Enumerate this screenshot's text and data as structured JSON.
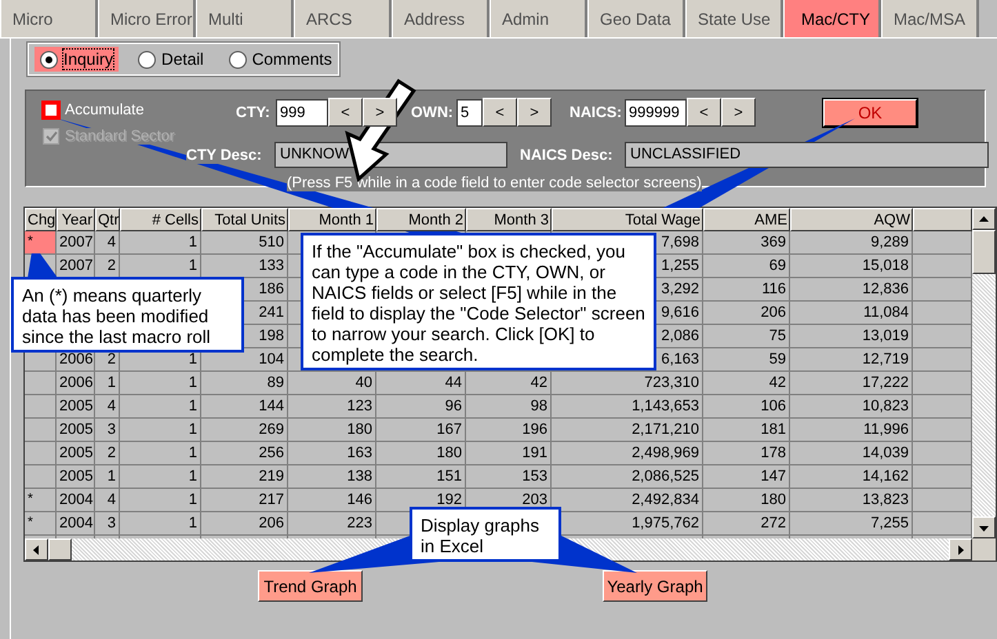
{
  "tabs": [
    {
      "label": "Micro",
      "selected": false
    },
    {
      "label": "Micro Error",
      "selected": false
    },
    {
      "label": "Multi",
      "selected": false
    },
    {
      "label": "ARCS",
      "selected": false
    },
    {
      "label": "Address",
      "selected": false
    },
    {
      "label": "Admin",
      "selected": false
    },
    {
      "label": "Geo Data",
      "selected": false
    },
    {
      "label": "State Use",
      "selected": false
    },
    {
      "label": "Mac/CTY",
      "selected": true
    },
    {
      "label": "Mac/MSA",
      "selected": false
    }
  ],
  "view_options": [
    {
      "label": "Inquiry",
      "selected": true
    },
    {
      "label": "Detail",
      "selected": false
    },
    {
      "label": "Comments",
      "selected": false
    }
  ],
  "filters": {
    "accumulate": {
      "label": "Accumulate",
      "checked": false,
      "disabled": false
    },
    "standard_sector": {
      "label": "Standard Sector",
      "checked": true,
      "disabled": true
    },
    "codes": [
      {
        "label": "CTY:",
        "value": "999",
        "stepper": [
          "<",
          ">"
        ]
      },
      {
        "label": "OWN:",
        "value": "5",
        "stepper": [
          "<",
          ">"
        ]
      },
      {
        "label": "NAICS:",
        "value": "999999",
        "stepper": [
          "<",
          ">"
        ]
      }
    ],
    "ok_button": "OK",
    "descriptions": [
      {
        "label": "CTY Desc:",
        "value": "UNKNOW"
      },
      {
        "label": "NAICS Desc:",
        "value": "UNCLASSIFIED"
      }
    ],
    "hint": "(Press F5 while in a code field to enter code selector screens)"
  },
  "table": {
    "columns": [
      "Chg",
      "Year",
      "Qtr",
      "# Cells",
      "Total Units",
      "Month 1",
      "Month 2",
      "Month 3",
      "Total Wage",
      "AME",
      "AQW"
    ],
    "rows": [
      {
        "highlighted": true,
        "cells": [
          "*",
          "2007",
          "4",
          "1",
          "510",
          null,
          null,
          null,
          "7,698",
          "369",
          "9,289"
        ]
      },
      {
        "highlighted": false,
        "cells": [
          null,
          "2007",
          "2",
          "1",
          "133",
          null,
          null,
          null,
          "1,255",
          "69",
          "15,018"
        ]
      },
      {
        "cells": [
          null,
          null,
          null,
          null,
          "186",
          null,
          null,
          null,
          "3,292",
          "116",
          "12,836"
        ]
      },
      {
        "cells": [
          null,
          null,
          null,
          null,
          "241",
          null,
          null,
          null,
          "9,616",
          "206",
          "11,084"
        ]
      },
      {
        "cells": [
          null,
          null,
          null,
          null,
          "198",
          null,
          null,
          null,
          "2,086",
          "75",
          "13,019"
        ]
      },
      {
        "highlighted": false,
        "cells": [
          null,
          "2006",
          "2",
          "1",
          "104",
          null,
          null,
          null,
          "6,163",
          "59",
          "12,719"
        ]
      },
      {
        "highlighted": false,
        "cells": [
          null,
          "2006",
          "1",
          "1",
          "89",
          "40",
          "44",
          "42",
          "723,310",
          "42",
          "17,222"
        ]
      },
      {
        "highlighted": false,
        "cells": [
          null,
          "2005",
          "4",
          "1",
          "144",
          "123",
          "96",
          "98",
          "1,143,653",
          "106",
          "10,823"
        ]
      },
      {
        "highlighted": false,
        "cells": [
          null,
          "2005",
          "3",
          "1",
          "269",
          "180",
          "167",
          "196",
          "2,171,210",
          "181",
          "11,996"
        ]
      },
      {
        "highlighted": false,
        "cells": [
          null,
          "2005",
          "2",
          "1",
          "256",
          "163",
          "180",
          "191",
          "2,498,969",
          "178",
          "14,039"
        ]
      },
      {
        "highlighted": false,
        "cells": [
          null,
          "2005",
          "1",
          "1",
          "219",
          "138",
          "151",
          "153",
          "2,086,525",
          "147",
          "14,162"
        ]
      },
      {
        "highlighted": false,
        "cells": [
          "*",
          "2004",
          "4",
          "1",
          "217",
          "146",
          "192",
          "203",
          "2,492,834",
          "180",
          "13,823"
        ]
      },
      {
        "highlighted": false,
        "cells": [
          "*",
          "2004",
          "3",
          "1",
          "206",
          "223",
          null,
          null,
          "1,975,762",
          "272",
          "7,255"
        ]
      }
    ]
  },
  "graph_buttons": [
    "Trend Graph",
    "Yearly Graph"
  ],
  "callouts": [
    {
      "text": "An (*) means quarterly data has been modified since the last macro roll"
    },
    {
      "text": "If the \"Accumulate\" box is checked, you can type a code in the CTY, OWN, or NAICS fields or select [F5] while in the field to display the \"Code Selector\" screen to narrow your search. Click [OK] to complete the search."
    },
    {
      "text": "Display graphs in Excel"
    }
  ]
}
